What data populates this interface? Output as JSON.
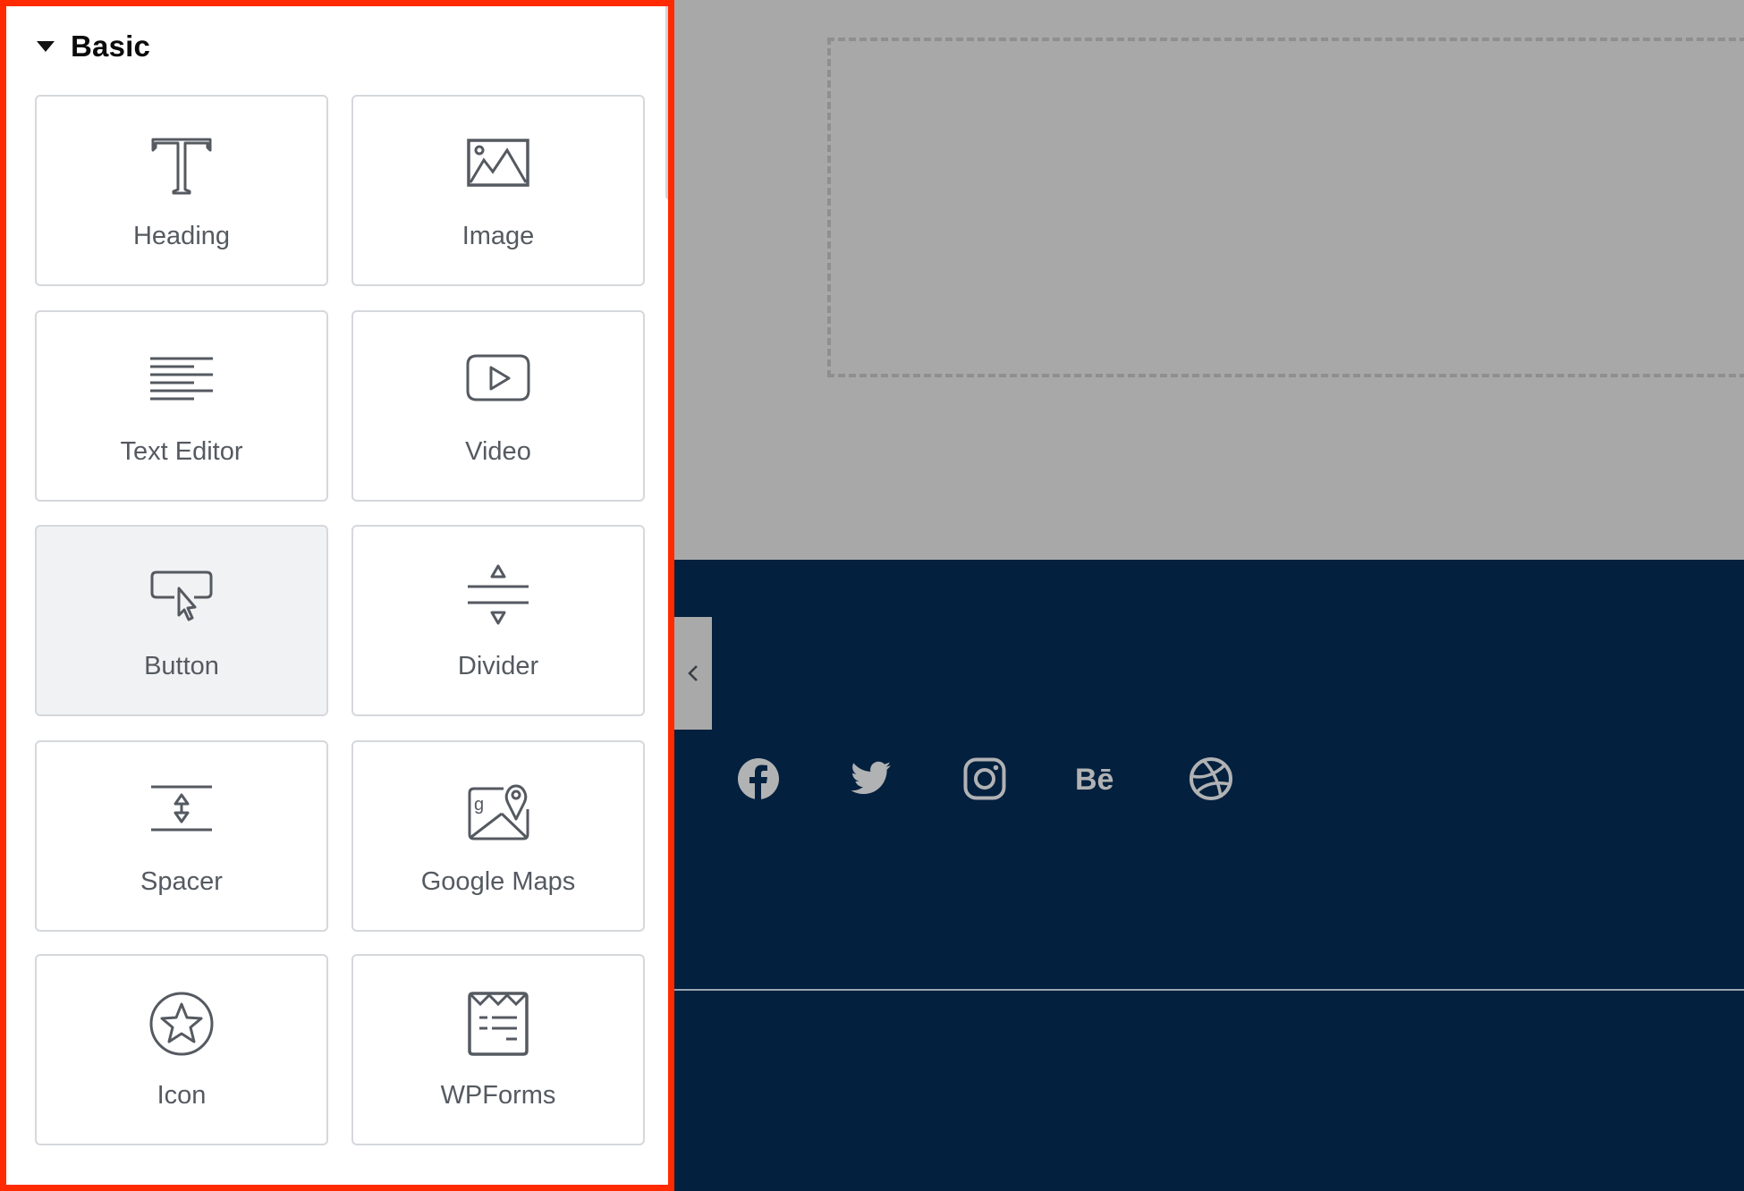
{
  "panel": {
    "section_title": "Basic",
    "section_state": "expanded",
    "widgets": [
      {
        "id": "heading",
        "label": "Heading",
        "icon": "heading-icon"
      },
      {
        "id": "image",
        "label": "Image",
        "icon": "image-icon"
      },
      {
        "id": "text-editor",
        "label": "Text Editor",
        "icon": "text-editor-icon"
      },
      {
        "id": "video",
        "label": "Video",
        "icon": "video-icon"
      },
      {
        "id": "button",
        "label": "Button",
        "icon": "button-icon",
        "hovered": true
      },
      {
        "id": "divider",
        "label": "Divider",
        "icon": "divider-icon"
      },
      {
        "id": "spacer",
        "label": "Spacer",
        "icon": "spacer-icon"
      },
      {
        "id": "google-maps",
        "label": "Google Maps",
        "icon": "google-maps-icon"
      },
      {
        "id": "icon",
        "label": "Icon",
        "icon": "star-icon"
      },
      {
        "id": "wpforms",
        "label": "WPForms",
        "icon": "wpforms-icon"
      }
    ],
    "highlight_color": "#ff2a00"
  },
  "canvas": {
    "background": "#a9a8a9",
    "footer_background": "#03203e",
    "social_icons": [
      {
        "name": "facebook",
        "icon": "facebook-icon",
        "glyph": "f"
      },
      {
        "name": "twitter",
        "icon": "twitter-icon",
        "glyph": ""
      },
      {
        "name": "instagram",
        "icon": "instagram-icon",
        "glyph": ""
      },
      {
        "name": "behance",
        "icon": "behance-icon",
        "glyph": "Bē"
      },
      {
        "name": "dribbble",
        "icon": "dribbble-icon",
        "glyph": ""
      }
    ]
  },
  "collapse_toggle": {
    "icon": "chevron-left-icon"
  }
}
